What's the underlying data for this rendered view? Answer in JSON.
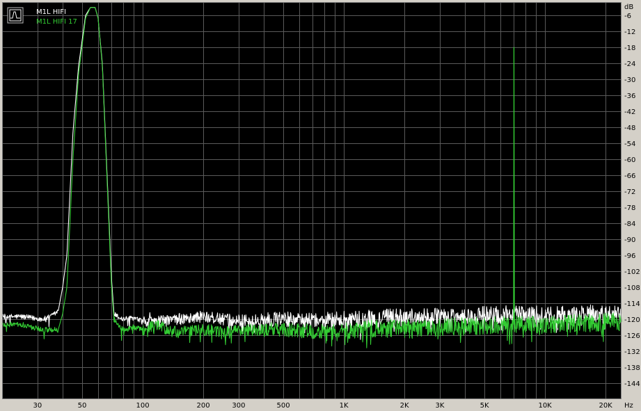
{
  "chart_data": {
    "type": "line",
    "xlabel": "Hz",
    "ylabel": "dB",
    "xscale": "log",
    "xlim": [
      20,
      24000
    ],
    "ylim": [
      -150,
      -1
    ],
    "y_ticks": [
      -6,
      -12,
      -18,
      -24,
      -30,
      -36,
      -42,
      -48,
      -54,
      -60,
      -66,
      -72,
      -78,
      -84,
      -90,
      -96,
      -102,
      -108,
      -114,
      -120,
      -126,
      -132,
      -138,
      -144
    ],
    "x_ticks": [
      {
        "value": 30,
        "label": "30"
      },
      {
        "value": 50,
        "label": "50"
      },
      {
        "value": 100,
        "label": "100"
      },
      {
        "value": 200,
        "label": "200"
      },
      {
        "value": 300,
        "label": "300"
      },
      {
        "value": 500,
        "label": "500"
      },
      {
        "value": 1000,
        "label": "1K"
      },
      {
        "value": 2000,
        "label": "2K"
      },
      {
        "value": 3000,
        "label": "3K"
      },
      {
        "value": 5000,
        "label": "5K"
      },
      {
        "value": 10000,
        "label": "10K"
      },
      {
        "value": 20000,
        "label": "20K"
      }
    ],
    "grid": true,
    "background": "#000000",
    "grid_color": "#5a5a5a",
    "legend_position": "top-left",
    "series": [
      {
        "name": "M1L HIFI",
        "color": "#ffffff",
        "points": [
          [
            20,
            -119
          ],
          [
            25,
            -119
          ],
          [
            28,
            -119.5
          ],
          [
            32,
            -120
          ],
          [
            35,
            -119
          ],
          [
            38,
            -117
          ],
          [
            40,
            -108
          ],
          [
            42,
            -96
          ],
          [
            45,
            -50
          ],
          [
            48,
            -25
          ],
          [
            52,
            -6
          ],
          [
            55,
            -3
          ],
          [
            58,
            -3
          ],
          [
            60,
            -7
          ],
          [
            63,
            -24
          ],
          [
            66,
            -60
          ],
          [
            70,
            -105
          ],
          [
            72,
            -118
          ],
          [
            75,
            -119
          ],
          [
            80,
            -120
          ],
          [
            90,
            -119.5
          ],
          [
            100,
            -121
          ],
          [
            110,
            -119.5
          ],
          [
            120,
            -121
          ],
          [
            150,
            -120
          ],
          [
            200,
            -119
          ],
          [
            250,
            -120
          ],
          [
            300,
            -120.5
          ],
          [
            400,
            -120
          ],
          [
            500,
            -120
          ],
          [
            700,
            -120
          ],
          [
            1000,
            -120
          ],
          [
            1500,
            -119.5
          ],
          [
            2000,
            -119
          ],
          [
            3000,
            -119
          ],
          [
            5000,
            -118.5
          ],
          [
            7000,
            -118
          ],
          [
            10000,
            -118.5
          ],
          [
            15000,
            -118
          ],
          [
            20000,
            -118
          ],
          [
            24000,
            -118
          ]
        ]
      },
      {
        "name": "M1L HIFI 17",
        "color": "#33cc33",
        "points": [
          [
            20,
            -122
          ],
          [
            25,
            -122
          ],
          [
            28,
            -123
          ],
          [
            32,
            -124
          ],
          [
            35,
            -124
          ],
          [
            38,
            -124
          ],
          [
            40,
            -118
          ],
          [
            42,
            -108
          ],
          [
            45,
            -60
          ],
          [
            48,
            -28
          ],
          [
            52,
            -7
          ],
          [
            55,
            -3
          ],
          [
            58,
            -3
          ],
          [
            60,
            -7
          ],
          [
            63,
            -25
          ],
          [
            66,
            -62
          ],
          [
            70,
            -108
          ],
          [
            72,
            -120
          ],
          [
            75,
            -122
          ],
          [
            80,
            -124
          ],
          [
            90,
            -123
          ],
          [
            100,
            -124
          ],
          [
            110,
            -123
          ],
          [
            120,
            -122
          ],
          [
            130,
            -124
          ],
          [
            150,
            -125
          ],
          [
            200,
            -124
          ],
          [
            250,
            -124.5
          ],
          [
            300,
            -124
          ],
          [
            400,
            -124
          ],
          [
            500,
            -124
          ],
          [
            700,
            -124.5
          ],
          [
            1000,
            -124
          ],
          [
            1500,
            -123.5
          ],
          [
            2000,
            -123.5
          ],
          [
            3000,
            -123
          ],
          [
            5000,
            -122.5
          ],
          [
            7000,
            -122
          ],
          [
            10000,
            -122
          ],
          [
            15000,
            -121.5
          ],
          [
            20000,
            -121
          ],
          [
            24000,
            -121
          ]
        ],
        "spikes": [
          {
            "hz": 7000,
            "db": -18
          },
          {
            "hz": 7025,
            "db": -64
          }
        ]
      }
    ]
  }
}
